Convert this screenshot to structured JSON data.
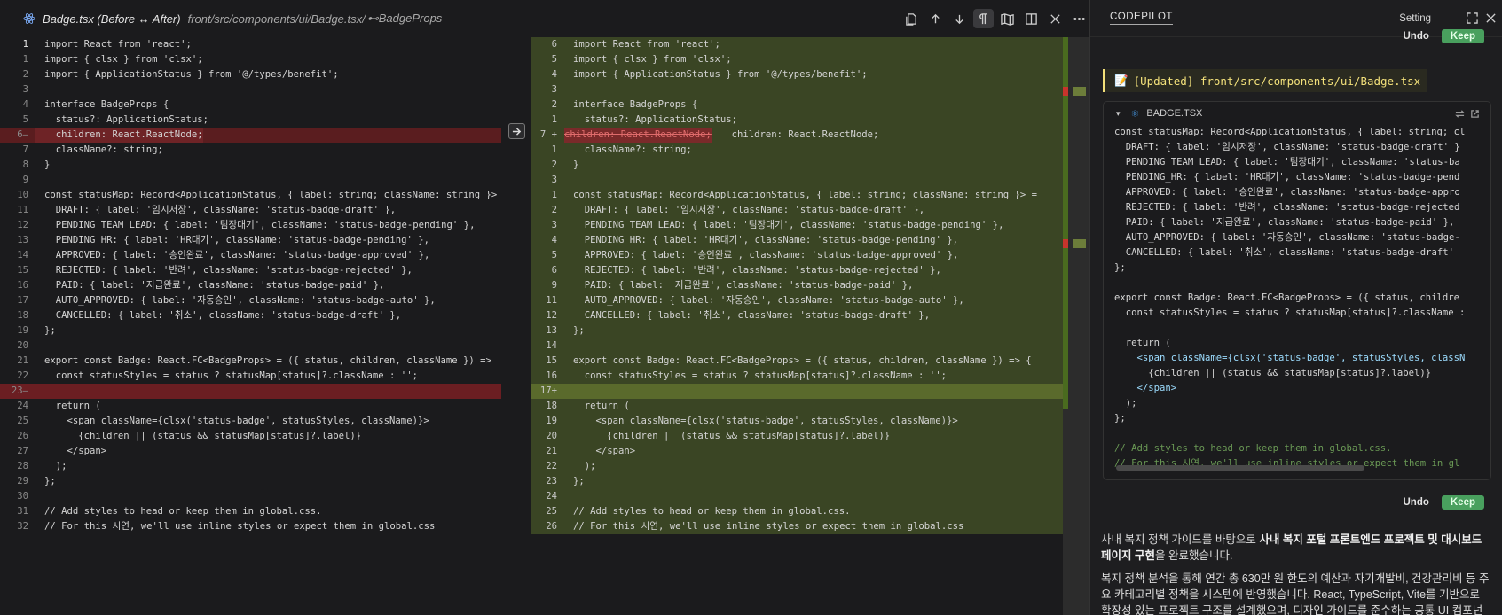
{
  "editor": {
    "tab_title": "Badge.tsx (Before ↔ After)",
    "tab_path": "front/src/components/ui/Badge.tsx/",
    "tab_symbol": "⊷BadgeProps"
  },
  "left_lines": [
    {
      "n": "1",
      "t": "import React from 'react';",
      "cls": "",
      "cur": true
    },
    {
      "n": "1",
      "t": "import { clsx } from 'clsx';",
      "cls": ""
    },
    {
      "n": "2",
      "t": "import { ApplicationStatus } from '@/types/benefit';",
      "cls": ""
    },
    {
      "n": "3",
      "t": "",
      "cls": ""
    },
    {
      "n": "4",
      "t": "interface BadgeProps {",
      "cls": ""
    },
    {
      "n": "5",
      "t": "  status?: ApplicationStatus;",
      "cls": ""
    },
    {
      "n": "6—",
      "t": "  children: React.ReactNode;",
      "cls": "del"
    },
    {
      "n": "7",
      "t": "  className?: string;",
      "cls": ""
    },
    {
      "n": "8",
      "t": "}",
      "cls": ""
    },
    {
      "n": "9",
      "t": "",
      "cls": ""
    },
    {
      "n": "10",
      "t": "const statusMap: Record<ApplicationStatus, { label: string; className: string }>",
      "cls": ""
    },
    {
      "n": "11",
      "t": "  DRAFT: { label: '임시저장', className: 'status-badge-draft' },",
      "cls": ""
    },
    {
      "n": "12",
      "t": "  PENDING_TEAM_LEAD: { label: '팀장대기', className: 'status-badge-pending' },",
      "cls": ""
    },
    {
      "n": "13",
      "t": "  PENDING_HR: { label: 'HR대기', className: 'status-badge-pending' },",
      "cls": ""
    },
    {
      "n": "14",
      "t": "  APPROVED: { label: '승인완료', className: 'status-badge-approved' },",
      "cls": ""
    },
    {
      "n": "15",
      "t": "  REJECTED: { label: '반려', className: 'status-badge-rejected' },",
      "cls": ""
    },
    {
      "n": "16",
      "t": "  PAID: { label: '지급완료', className: 'status-badge-paid' },",
      "cls": ""
    },
    {
      "n": "17",
      "t": "  AUTO_APPROVED: { label: '자동승인', className: 'status-badge-auto' },",
      "cls": ""
    },
    {
      "n": "18",
      "t": "  CANCELLED: { label: '취소', className: 'status-badge-draft' },",
      "cls": ""
    },
    {
      "n": "19",
      "t": "};",
      "cls": ""
    },
    {
      "n": "20",
      "t": "",
      "cls": ""
    },
    {
      "n": "21",
      "t": "export const Badge: React.FC<BadgeProps> = ({ status, children, className }) =>",
      "cls": ""
    },
    {
      "n": "22",
      "t": "  const statusStyles = status ? statusMap[status]?.className : '';",
      "cls": ""
    },
    {
      "n": "23—",
      "t": "",
      "cls": "gap"
    },
    {
      "n": "24",
      "t": "  return (",
      "cls": ""
    },
    {
      "n": "25",
      "t": "    <span className={clsx('status-badge', statusStyles, className)}>",
      "cls": ""
    },
    {
      "n": "26",
      "t": "      {children || (status && statusMap[status]?.label)}",
      "cls": ""
    },
    {
      "n": "27",
      "t": "    </span>",
      "cls": ""
    },
    {
      "n": "28",
      "t": "  );",
      "cls": ""
    },
    {
      "n": "29",
      "t": "};",
      "cls": ""
    },
    {
      "n": "30",
      "t": "",
      "cls": ""
    },
    {
      "n": "31",
      "t": "// Add styles to head or keep them in global.css.",
      "cls": ""
    },
    {
      "n": "32",
      "t": "// For this 시연, we'll use inline styles or expect them in global.css",
      "cls": ""
    }
  ],
  "right_lines": [
    {
      "n": "6",
      "t": "import React from 'react';"
    },
    {
      "n": "5",
      "t": "import { clsx } from 'clsx';"
    },
    {
      "n": "4",
      "t": "import { ApplicationStatus } from '@/types/benefit';"
    },
    {
      "n": "3",
      "t": ""
    },
    {
      "n": "2",
      "t": "interface BadgeProps {"
    },
    {
      "n": "1",
      "t": "  status?: ApplicationStatus;"
    },
    {
      "n": "7 +",
      "t": "  children: React.ReactNode;",
      "strike": "children: React.ReactNode;",
      "cur": true
    },
    {
      "n": "1",
      "t": "  className?: string;"
    },
    {
      "n": "2",
      "t": "}"
    },
    {
      "n": "3",
      "t": ""
    },
    {
      "n": "1",
      "t": "const statusMap: Record<ApplicationStatus, { label: string; className: string }> ="
    },
    {
      "n": "2",
      "t": "  DRAFT: { label: '임시저장', className: 'status-badge-draft' },"
    },
    {
      "n": "3",
      "t": "  PENDING_TEAM_LEAD: { label: '팀장대기', className: 'status-badge-pending' },"
    },
    {
      "n": "4",
      "t": "  PENDING_HR: { label: 'HR대기', className: 'status-badge-pending' },"
    },
    {
      "n": "5",
      "t": "  APPROVED: { label: '승인완료', className: 'status-badge-approved' },"
    },
    {
      "n": "6",
      "t": "  REJECTED: { label: '반려', className: 'status-badge-rejected' },"
    },
    {
      "n": "9",
      "t": "  PAID: { label: '지급완료', className: 'status-badge-paid' },"
    },
    {
      "n": "11",
      "t": "  AUTO_APPROVED: { label: '자동승인', className: 'status-badge-auto' },"
    },
    {
      "n": "12",
      "t": "  CANCELLED: { label: '취소', className: 'status-badge-draft' },"
    },
    {
      "n": "13",
      "t": "};"
    },
    {
      "n": "14",
      "t": ""
    },
    {
      "n": "15",
      "t": "export const Badge: React.FC<BadgeProps> = ({ status, children, className }) => {"
    },
    {
      "n": "16",
      "t": "  const statusStyles = status ? statusMap[status]?.className : '';"
    },
    {
      "n": "17+",
      "t": "",
      "add": true
    },
    {
      "n": "18",
      "t": "  return ("
    },
    {
      "n": "19",
      "t": "    <span className={clsx('status-badge', statusStyles, className)}>"
    },
    {
      "n": "20",
      "t": "      {children || (status && statusMap[status]?.label)}"
    },
    {
      "n": "21",
      "t": "    </span>"
    },
    {
      "n": "22",
      "t": "  );"
    },
    {
      "n": "23",
      "t": "};"
    },
    {
      "n": "24",
      "t": ""
    },
    {
      "n": "25",
      "t": "// Add styles to head or keep them in global.css."
    },
    {
      "n": "26",
      "t": "// For this 시연, we'll use inline styles or expect them in global.css"
    }
  ],
  "chat": {
    "panel_title": "CODEPILOT",
    "setting_label": "Setting",
    "undo_label": "Undo",
    "keep_label": "Keep",
    "updated_memo_icon": "📝",
    "updated_text": "[Updated] front/src/components/ui/Badge.tsx",
    "card_filename": "BADGE.TSX",
    "card_lines": [
      "const statusMap: Record<ApplicationStatus, { label: string; cl",
      "  DRAFT: { label: '임시저장', className: 'status-badge-draft' }",
      "  PENDING_TEAM_LEAD: { label: '팀장대기', className: 'status-ba",
      "  PENDING_HR: { label: 'HR대기', className: 'status-badge-pend",
      "  APPROVED: { label: '승인완료', className: 'status-badge-appro",
      "  REJECTED: { label: '반려', className: 'status-badge-rejected",
      "  PAID: { label: '지급완료', className: 'status-badge-paid' },",
      "  AUTO_APPROVED: { label: '자동승인', className: 'status-badge-",
      "  CANCELLED: { label: '취소', className: 'status-badge-draft'",
      "};",
      "",
      "export const Badge: React.FC<BadgeProps> = ({ status, childre",
      "  const statusStyles = status ? statusMap[status]?.className :",
      "",
      "  return (",
      "    <span className={clsx('status-badge', statusStyles, classN",
      "      {children || (status && statusMap[status]?.label)}",
      "    </span>",
      "  );",
      "};",
      "",
      "// Add styles to head or keep them in global.css.",
      "// For this 시연, we'll use inline styles or expect them in gl"
    ],
    "para1_pre": "사내 복지 정책 가이드를 바탕으로 ",
    "para1_bold": "사내 복지 포털 프론트엔드 프로젝트 및 대시보드 페이지 구현",
    "para1_post": "을 완료했습니다.",
    "para2": "복지 정책 분석을 통해 연간 총 630만 원 한도의 예산과 자기개발비, 건강관리비 등 주요 카테고리별 정책을 시스템에 반영했습니다. React, TypeScript, Vite를 기반으로 확장성 있는 프로젝트 구조를 설계했으며, 디자인 가이드를 준수하는 공통 UI 컴포넌트"
  }
}
